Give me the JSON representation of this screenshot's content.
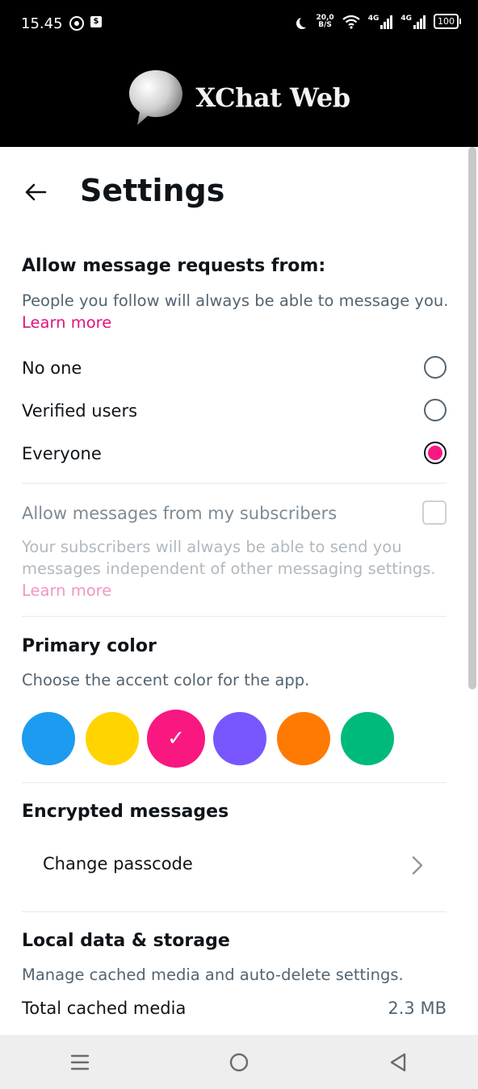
{
  "status_bar": {
    "time": "15.45",
    "network_speed": "20,0",
    "network_speed_unit": "B/S",
    "signal1_label": "4G",
    "signal2_label": "4G",
    "battery": "100"
  },
  "app": {
    "title": "XChat Web"
  },
  "page": {
    "title": "Settings"
  },
  "message_requests": {
    "title": "Allow message requests from:",
    "description": "People you follow will always be able to message you.",
    "learn_more": "Learn more",
    "options": [
      {
        "label": "No one",
        "selected": false
      },
      {
        "label": "Verified users",
        "selected": false
      },
      {
        "label": "Everyone",
        "selected": true
      }
    ]
  },
  "subscribers": {
    "label": "Allow messages from my subscribers",
    "checked": false,
    "description": "Your subscribers will always be able to send you messages independent of other messaging settings.",
    "learn_more": "Learn more"
  },
  "primary_color": {
    "title": "Primary color",
    "description": "Choose the accent color for the app.",
    "colors": [
      {
        "name": "blue",
        "hex": "#1d9bf0",
        "selected": false
      },
      {
        "name": "yellow",
        "hex": "#ffd400",
        "selected": false
      },
      {
        "name": "pink",
        "hex": "#f91880",
        "selected": true
      },
      {
        "name": "purple",
        "hex": "#7856ff",
        "selected": false
      },
      {
        "name": "orange",
        "hex": "#ff7a00",
        "selected": false
      },
      {
        "name": "green",
        "hex": "#00ba7c",
        "selected": false
      }
    ],
    "check_glyph": "✓"
  },
  "encrypted_messages": {
    "title": "Encrypted messages",
    "change_passcode": "Change passcode"
  },
  "local_data": {
    "title": "Local data & storage",
    "description": "Manage cached media and auto-delete settings.",
    "total_cached_label": "Total cached media",
    "total_cached_value": "2.3 MB"
  },
  "colors": {
    "accent": "#f91880",
    "link": "#e0147a",
    "secondary_text": "#536471",
    "divider": "#e7e9ea"
  },
  "icons": {
    "back": "arrow-left-icon",
    "chevron": "chevron-right-icon",
    "nav_recents": "menu-lines-icon",
    "nav_home": "circle-icon",
    "nav_back": "triangle-back-icon"
  }
}
